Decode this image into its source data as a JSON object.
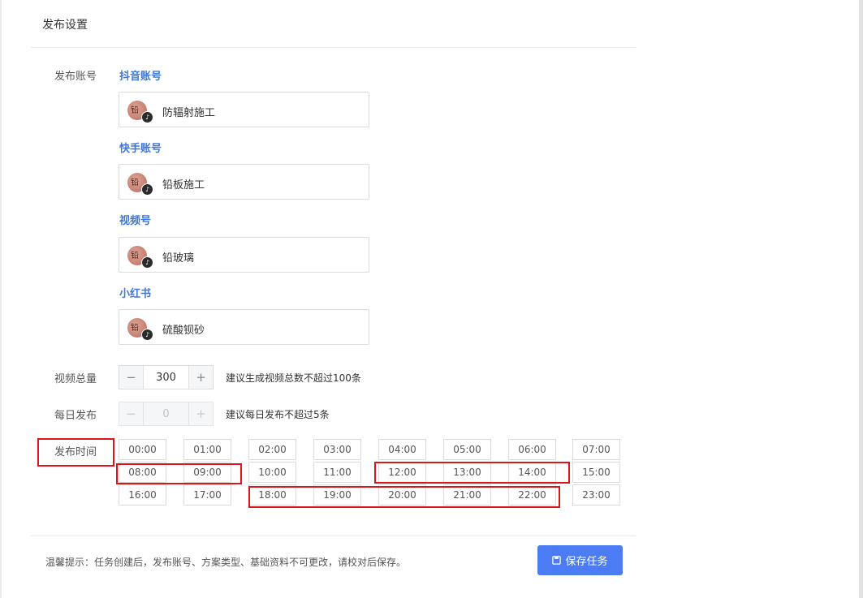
{
  "header": {
    "title": "发布设置"
  },
  "accounts_section": {
    "label": "发布账号",
    "groups": [
      {
        "platform": "抖音账号",
        "account": "防辐射施工",
        "avatar_text": "铅"
      },
      {
        "platform": "快手账号",
        "account": "铅板施工",
        "avatar_text": "铅"
      },
      {
        "platform": "视频号",
        "account": "铅玻璃",
        "avatar_text": "铅"
      },
      {
        "platform": "小红书",
        "account": "硫酸钡砂",
        "avatar_text": "铅"
      }
    ],
    "badge_icon": "tiktok-icon"
  },
  "video_total": {
    "label": "视频总量",
    "value": "300",
    "minus": "−",
    "plus": "+",
    "hint": "建议生成视频总数不超过100条"
  },
  "daily_publish": {
    "label": "每日发布",
    "value": "0",
    "minus": "−",
    "plus": "+",
    "hint": "建议每日发布不超过5条",
    "disabled": true
  },
  "publish_time": {
    "label": "发布时间",
    "slots": [
      "00:00",
      "01:00",
      "02:00",
      "03:00",
      "04:00",
      "05:00",
      "06:00",
      "07:00",
      "08:00",
      "09:00",
      "10:00",
      "11:00",
      "12:00",
      "13:00",
      "14:00",
      "15:00",
      "16:00",
      "17:00",
      "18:00",
      "19:00",
      "20:00",
      "21:00",
      "22:00",
      "23:00"
    ],
    "highlighted": [
      "08:00",
      "09:00",
      "12:00",
      "13:00",
      "14:00",
      "18:00",
      "19:00",
      "20:00",
      "21:00",
      "22:00"
    ]
  },
  "footer": {
    "tip": "温馨提示：任务创建后，发布账号、方案类型、基础资料不可更改，请校对后保存。",
    "save_label": "保存任务",
    "save_icon": "save-icon"
  },
  "colors": {
    "accent": "#4c7cf3",
    "platform_label": "#3f77d9",
    "highlight": "#d9161b"
  }
}
